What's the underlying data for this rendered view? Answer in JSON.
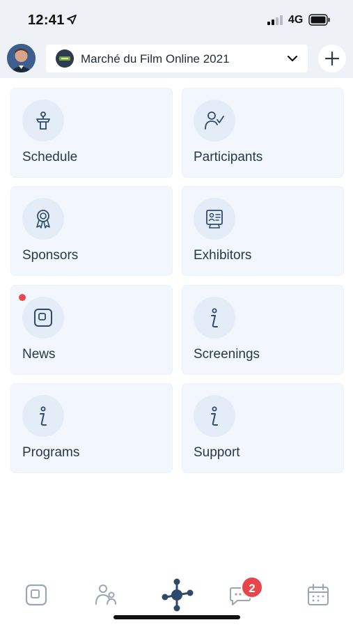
{
  "status": {
    "time": "12:41",
    "network": "4G"
  },
  "header": {
    "event_name": "Marché du Film Online 2021",
    "icons": [
      "avatar",
      "event-logo",
      "chevron-down-icon",
      "plus-icon"
    ]
  },
  "tiles": [
    {
      "label": "Schedule",
      "icon": "podium-icon"
    },
    {
      "label": "Participants",
      "icon": "participant-check-icon"
    },
    {
      "label": "Sponsors",
      "icon": "award-ribbon-icon"
    },
    {
      "label": "Exhibitors",
      "icon": "id-card-icon"
    },
    {
      "label": "News",
      "icon": "square-icon",
      "unread_dot": true
    },
    {
      "label": "Screenings",
      "icon": "info-icon"
    },
    {
      "label": "Programs",
      "icon": "info-icon"
    },
    {
      "label": "Support",
      "icon": "info-icon"
    }
  ],
  "tabbar": {
    "items": [
      "home-square-icon",
      "people-icon",
      "network-hub-icon",
      "chat-icon",
      "calendar-icon"
    ],
    "chat_badge": "2"
  },
  "colors": {
    "accent": "#2e4a6b",
    "tile_bg": "#f2f7fd",
    "badge": "#e8474a",
    "header_bg": "#eef1f5"
  }
}
